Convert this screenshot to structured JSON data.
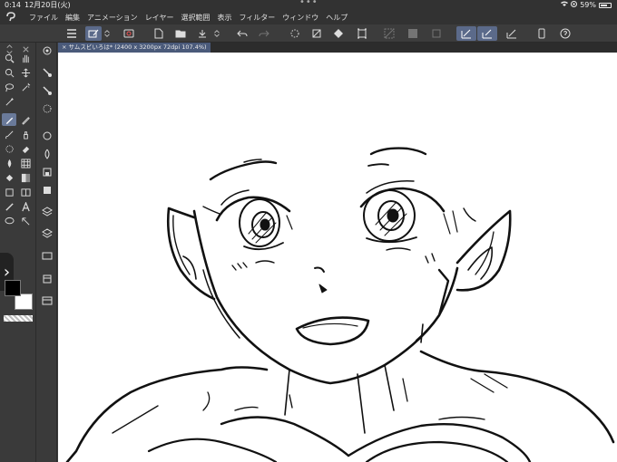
{
  "status_bar": {
    "time": "0:14",
    "date": "12月20日(火)",
    "battery": "59%",
    "battery_level": 0.59
  },
  "menu": {
    "items": [
      "ファイル",
      "編集",
      "アニメーション",
      "レイヤー",
      "選択範囲",
      "表示",
      "フィルター",
      "ウィンドウ",
      "ヘルプ"
    ]
  },
  "document": {
    "tab_label": "サムスビいろは* (2400 x 3200px 72dpi 107.4%)"
  },
  "colors": {
    "main_color": "#000000",
    "sub_color": "#ffffff",
    "accent": "#5b6a8a"
  },
  "canvas_content": "line-art sketch of a smiling character with pointed ears"
}
